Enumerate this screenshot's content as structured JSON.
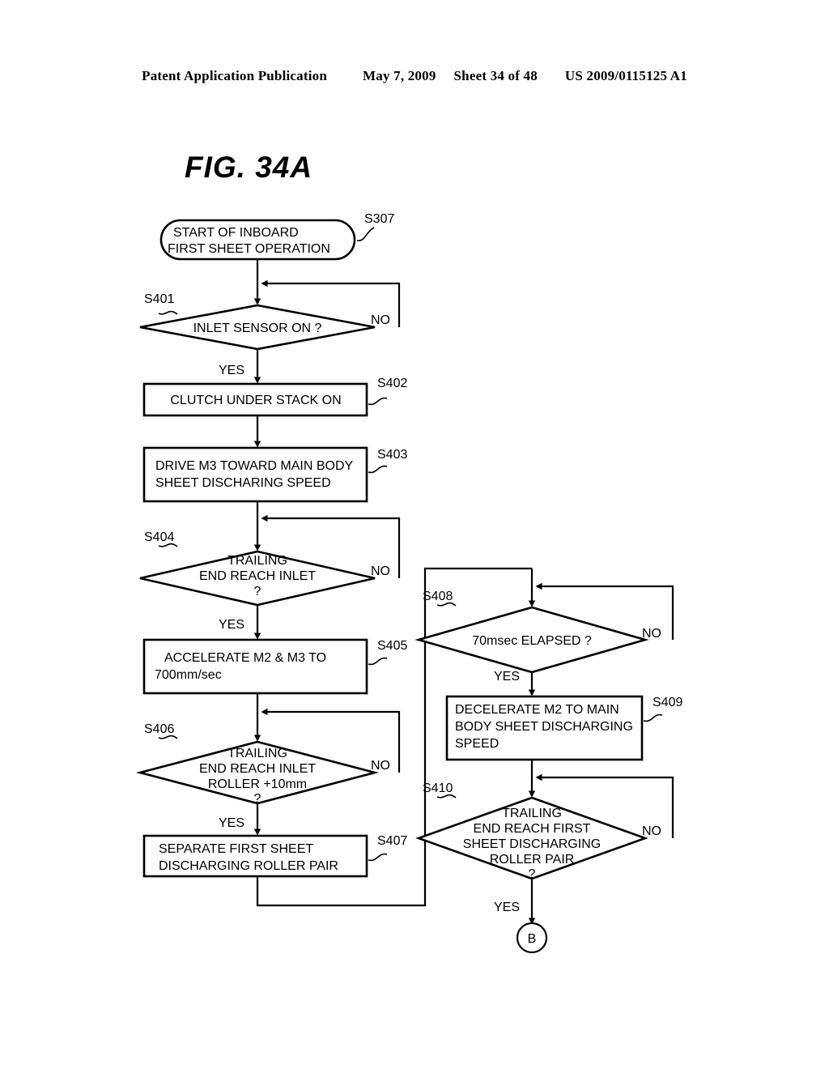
{
  "header": {
    "publication": "Patent Application Publication",
    "date": "May 7, 2009",
    "sheet": "Sheet 34 of 48",
    "patent_number": "US 2009/0115125 A1"
  },
  "figure": {
    "title": "FIG.  34A"
  },
  "flowchart": {
    "nodes": {
      "start": {
        "id": "S307",
        "type": "terminator",
        "line1": "START OF INBOARD",
        "line2": "FIRST SHEET OPERATION"
      },
      "s401": {
        "id": "S401",
        "type": "decision",
        "line1": "INLET SENSOR ON ?",
        "yes": "YES",
        "no": "NO"
      },
      "s402": {
        "id": "S402",
        "type": "process",
        "line1": "CLUTCH UNDER STACK ON"
      },
      "s403": {
        "id": "S403",
        "type": "process",
        "line1": "DRIVE M3 TOWARD MAIN BODY",
        "line2": "SHEET DISCHARING SPEED"
      },
      "s404": {
        "id": "S404",
        "type": "decision",
        "line1": "TRAILING",
        "line2": "END REACH INLET",
        "line3": "?",
        "yes": "YES",
        "no": "NO"
      },
      "s405": {
        "id": "S405",
        "type": "process",
        "line1": "ACCELERATE M2 & M3 TO",
        "line2": "700mm/sec"
      },
      "s406": {
        "id": "S406",
        "type": "decision",
        "line1": "TRAILING",
        "line2": "END REACH INLET",
        "line3": "ROLLER +10mm",
        "line4": "?",
        "yes": "YES",
        "no": "NO"
      },
      "s407": {
        "id": "S407",
        "type": "process",
        "line1": "SEPARATE FIRST SHEET",
        "line2": "DISCHARGING ROLLER PAIR"
      },
      "s408": {
        "id": "S408",
        "type": "decision",
        "line1": "70msec ELAPSED ?",
        "yes": "YES",
        "no": "NO"
      },
      "s409": {
        "id": "S409",
        "type": "process",
        "line1": "DECELERATE M2 TO MAIN",
        "line2": "BODY SHEET DISCHARGING",
        "line3": "SPEED"
      },
      "s410": {
        "id": "S410",
        "type": "decision",
        "line1": "TRAILING",
        "line2": "END REACH FIRST",
        "line3": "SHEET DISCHARGING",
        "line4": "ROLLER PAIR",
        "line5": "?",
        "yes": "YES",
        "no": "NO"
      },
      "connector_b": {
        "type": "connector",
        "label": "B"
      }
    }
  }
}
